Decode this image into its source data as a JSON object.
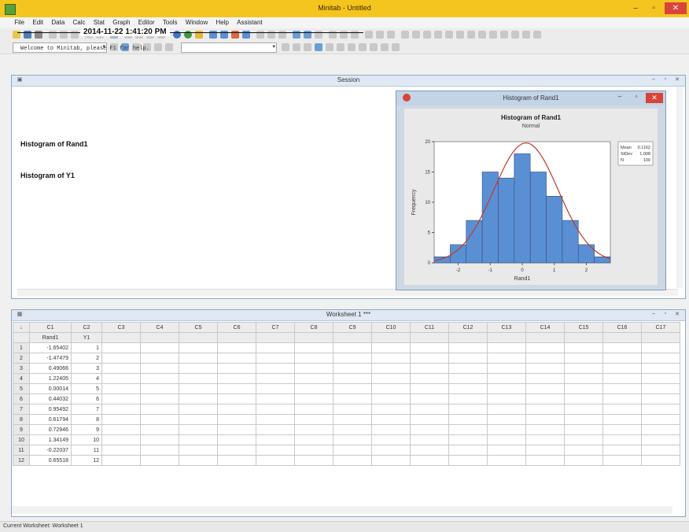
{
  "window": {
    "title": "Minitab - Untitled",
    "min": "–",
    "max": "▫",
    "close": "✕"
  },
  "menu": [
    "File",
    "Edit",
    "Data",
    "Calc",
    "Stat",
    "Graph",
    "Editor",
    "Tools",
    "Window",
    "Help",
    "Assistant"
  ],
  "session": {
    "title": "Session",
    "timestamp": "2014-11-22 1:41:20 PM",
    "welcome": "Welcome to Minitab, please F1 for help.",
    "headings": [
      "Histogram of Rand1",
      "Histogram of Y1"
    ]
  },
  "graph": {
    "window_title": "Histogram of Rand1",
    "chart_data": {
      "type": "bar",
      "title": "Histogram of Rand1",
      "subtitle": "Normal",
      "xlabel": "Rand1",
      "ylabel": "Frequency",
      "x_ticks": [
        "-2",
        "-1",
        "0",
        "1",
        "2"
      ],
      "y_ticks": [
        "0",
        "5",
        "10",
        "15",
        "20"
      ],
      "bin_edges": [
        -2.75,
        -2.25,
        -1.75,
        -1.25,
        -0.75,
        -0.25,
        0.25,
        0.75,
        1.25,
        1.75,
        2.25,
        2.75
      ],
      "values": [
        1,
        3,
        7,
        15,
        14,
        18,
        15,
        11,
        7,
        3,
        1
      ],
      "ylim": [
        0,
        20
      ],
      "xlim": [
        -2.75,
        2.75
      ],
      "fit_curve": "normal",
      "legend": {
        "position": "top-right",
        "rows": [
          [
            "Mean",
            "0.1162"
          ],
          [
            "StDev",
            "1.008"
          ],
          [
            "N",
            "100"
          ]
        ]
      },
      "colors": {
        "bars": "#5b8fd4",
        "bar_edge": "#2f4f7a",
        "fit_line": "#c0392b",
        "plot_bg": "#ffffff"
      }
    }
  },
  "worksheet": {
    "title": "Worksheet 1 ***",
    "columns": [
      "C1",
      "C2",
      "C3",
      "C4",
      "C5",
      "C6",
      "C7",
      "C8",
      "C9",
      "C10",
      "C11",
      "C12",
      "C13",
      "C14",
      "C15",
      "C16",
      "C17"
    ],
    "col_names": [
      "Rand1",
      "Y1"
    ],
    "rows": [
      [
        "1",
        "-1.65402",
        "1"
      ],
      [
        "2",
        "-1.47479",
        "2"
      ],
      [
        "3",
        "0.49066",
        "3"
      ],
      [
        "4",
        "1.22405",
        "4"
      ],
      [
        "5",
        "0.00014",
        "5"
      ],
      [
        "6",
        "0.44032",
        "6"
      ],
      [
        "7",
        "0.95492",
        "7"
      ],
      [
        "8",
        "0.61794",
        "8"
      ],
      [
        "9",
        "0.72946",
        "9"
      ],
      [
        "10",
        "1.34149",
        "10"
      ],
      [
        "11",
        "-0.22037",
        "11"
      ],
      [
        "12",
        "0.65518",
        "12"
      ]
    ]
  },
  "status": {
    "text": "Current Worksheet: Worksheet 1"
  }
}
